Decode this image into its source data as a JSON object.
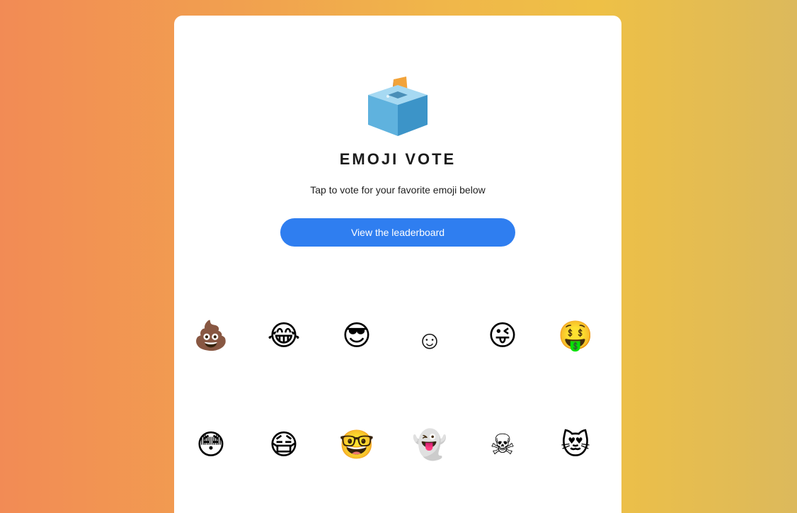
{
  "header": {
    "title": "EMOJI VOTE",
    "subtitle": "Tap to vote for your favorite emoji below"
  },
  "actions": {
    "leaderboard_label": "View the leaderboard"
  },
  "colors": {
    "button": "#2f7ef0",
    "card": "#ffffff"
  },
  "emojis": [
    {
      "glyph": "💩",
      "name": "pile-of-poo-emoji"
    },
    {
      "glyph": "😂",
      "name": "tears-of-joy-emoji"
    },
    {
      "glyph": "😎",
      "name": "sunglasses-emoji"
    },
    {
      "glyph": "☺",
      "name": "smiling-face-emoji"
    },
    {
      "glyph": "😜",
      "name": "winking-tongue-emoji"
    },
    {
      "glyph": "🤑",
      "name": "money-mouth-emoji"
    },
    {
      "glyph": "😳",
      "name": "flushed-emoji"
    },
    {
      "glyph": "😷",
      "name": "medical-mask-emoji"
    },
    {
      "glyph": "🤓",
      "name": "nerd-emoji"
    },
    {
      "glyph": "👻",
      "name": "ghost-emoji"
    },
    {
      "glyph": "☠",
      "name": "skull-crossbones-emoji"
    },
    {
      "glyph": "😻",
      "name": "heart-eyes-cat-emoji"
    }
  ]
}
